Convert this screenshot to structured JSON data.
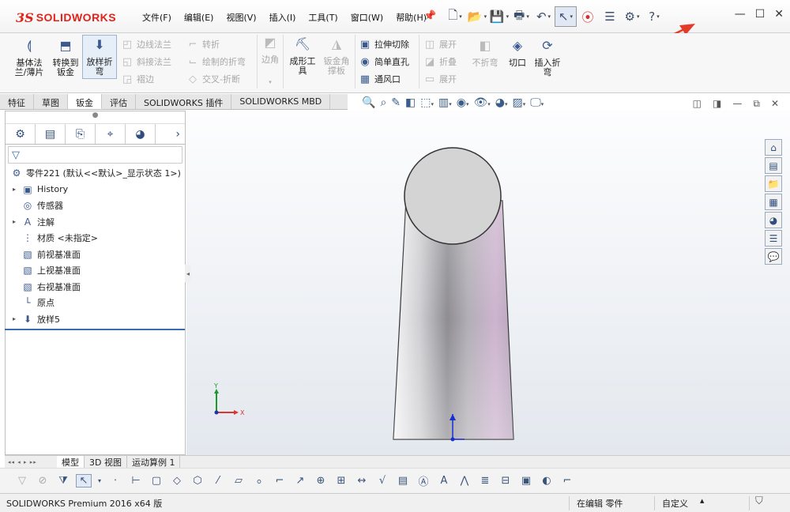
{
  "app": {
    "logo_ds": "3S",
    "logo_name": "SOLIDWORKS"
  },
  "menu": [
    "文件(F)",
    "编辑(E)",
    "视图(V)",
    "插入(I)",
    "工具(T)",
    "窗口(W)",
    "帮助(H)"
  ],
  "ribbon": {
    "base_flange": "基体法兰/薄片",
    "convert_sheet": "转换到钣金",
    "lofted_bend": "放样折弯",
    "edge_flange": "边线法兰",
    "miter_flange": "斜接法兰",
    "hem": "褶边",
    "jog": "转折",
    "sketched_bend": "绘制的折弯",
    "cross_break": "交叉-折断",
    "corner": "边角",
    "forming_tool": "成形工具",
    "sheet_metal_gusset": "钣金角撑板",
    "extruded_cut": "拉伸切除",
    "simple_hole": "简单直孔",
    "vent": "通风口",
    "unfold": "展开",
    "fold": "折叠",
    "flatten": "展开",
    "no_bends": "不折弯",
    "rip": "切口",
    "insert_bends": "插入折弯"
  },
  "command_tabs": [
    "特征",
    "草图",
    "钣金",
    "评估",
    "SOLIDWORKS 插件",
    "SOLIDWORKS MBD"
  ],
  "feature_tree": {
    "part_name": "零件221  (默认<<默认>_显示状态 1>)",
    "items": [
      {
        "label": "History",
        "expand": "▸",
        "icon": "▣"
      },
      {
        "label": "传感器",
        "expand": "",
        "icon": "◎"
      },
      {
        "label": "注解",
        "expand": "▸",
        "icon": "A"
      },
      {
        "label": "材质 <未指定>",
        "expand": "",
        "icon": "⋮"
      },
      {
        "label": "前视基准面",
        "expand": "",
        "icon": "▧"
      },
      {
        "label": "上视基准面",
        "expand": "",
        "icon": "▧"
      },
      {
        "label": "右视基准面",
        "expand": "",
        "icon": "▧"
      },
      {
        "label": "原点",
        "expand": "",
        "icon": "└"
      },
      {
        "label": "放样5",
        "expand": "▸",
        "icon": "⬇"
      }
    ]
  },
  "triad": {
    "y": "Y",
    "x": "X"
  },
  "bottom_tabs": [
    "模型",
    "3D 视图",
    "运动算例 1"
  ],
  "status": {
    "product": "SOLIDWORKS Premium 2016 x64 版",
    "mode": "在编辑 零件",
    "custom": "自定义"
  },
  "colors": {
    "brand_red": "#e2231a",
    "accent_blue": "#3a6cb3",
    "annotation_arrow": "#e33a2a"
  }
}
